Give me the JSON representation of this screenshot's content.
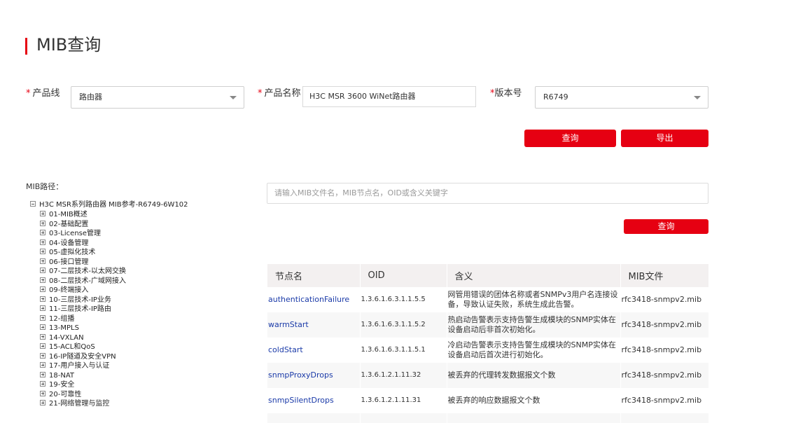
{
  "page": {
    "title": "MIB查询"
  },
  "form": {
    "product_line_label": "产品线",
    "product_line_value": "路由器",
    "product_name_label": "产品名称",
    "product_name_value": "H3C MSR 3600 WiNet路由器",
    "version_label": "版本号",
    "version_value": "R6749",
    "required_mark": "*",
    "query_button": "查询",
    "export_button": "导出"
  },
  "mib_path": {
    "label": "MIB路径：",
    "root": "H3C MSR系列路由器 MIB参考-R6749-6W102",
    "items": [
      "01-MIB概述",
      "02-基础配置",
      "03-License管理",
      "04-设备管理",
      "05-虚拟化技术",
      "06-接口管理",
      "07-二层技术-以太网交换",
      "08-二层技术-广域网接入",
      "09-终端接入",
      "10-三层技术-IP业务",
      "11-三层技术-IP路由",
      "12-组播",
      "13-MPLS",
      "14-VXLAN",
      "15-ACL和QoS",
      "16-IP隧道及安全VPN",
      "17-用户接入与认证",
      "18-NAT",
      "19-安全",
      "20-可靠性",
      "21-网络管理与监控"
    ]
  },
  "search": {
    "placeholder": "请输入MIB文件名，MIB节点名，OID或含义关键字",
    "button": "查询"
  },
  "table": {
    "headers": [
      "节点名",
      "OID",
      "含义",
      "MIB文件"
    ],
    "rows": [
      {
        "name": "authenticationFailure",
        "oid": "1.3.6.1.6.3.1.1.5.5",
        "meaning": "网管用错误的团体名称或者SNMPv3用户名连接设备，导致认证失败，系统生成此告警。",
        "file": "rfc3418-snmpv2.mib"
      },
      {
        "name": "warmStart",
        "oid": "1.3.6.1.6.3.1.1.5.2",
        "meaning": "热启动告警表示支持告警生成模块的SNMP实体在设备启动后非首次初始化。",
        "file": "rfc3418-snmpv2.mib"
      },
      {
        "name": "coldStart",
        "oid": "1.3.6.1.6.3.1.1.5.1",
        "meaning": "冷启动告警表示支持告警生成模块的SNMP实体在设备启动后首次进行初始化。",
        "file": "rfc3418-snmpv2.mib"
      },
      {
        "name": "snmpProxyDrops",
        "oid": "1.3.6.1.2.1.11.32",
        "meaning": "被丢弃的代理转发数据报文个数",
        "file": "rfc3418-snmpv2.mib"
      },
      {
        "name": "snmpSilentDrops",
        "oid": "1.3.6.1.2.1.11.31",
        "meaning": "被丢弃的响应数据报文个数",
        "file": "rfc3418-snmpv2.mib"
      }
    ]
  },
  "colors": {
    "accent": "#e60012",
    "link": "#1a3aa8",
    "header_bg": "#f3f0f0"
  }
}
